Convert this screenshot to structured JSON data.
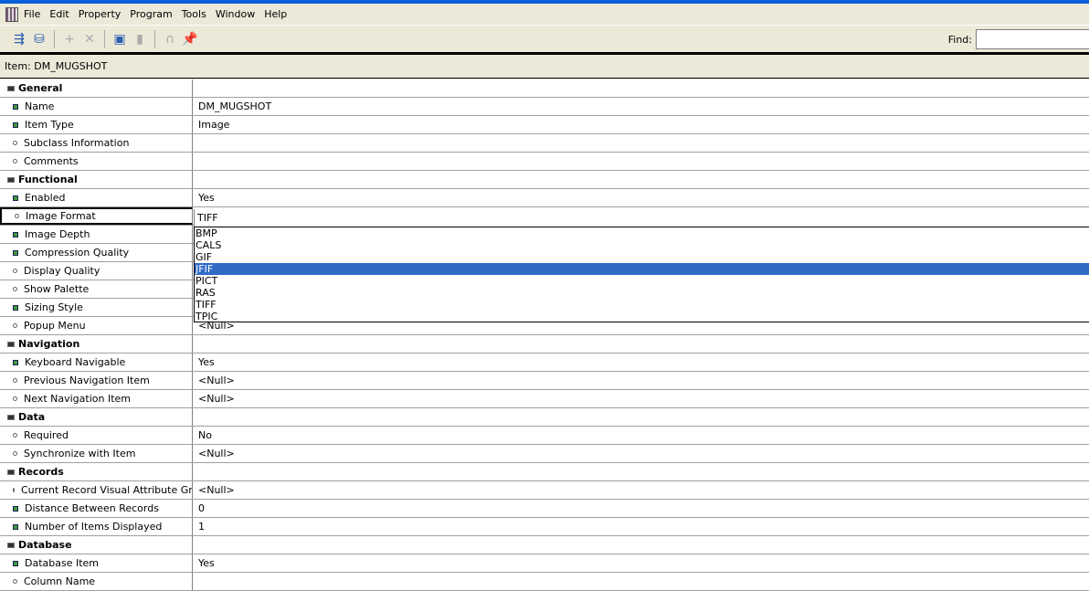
{
  "menu": [
    "File",
    "Edit",
    "Property",
    "Program",
    "Tools",
    "Window",
    "Help"
  ],
  "toolbar": {
    "icons": [
      "expand-tree-icon",
      "collapse-tree-icon",
      "add-property-icon",
      "delete-property-icon",
      "copy-properties-icon",
      "paste-properties-icon",
      "intersection-icon",
      "pin-icon"
    ],
    "find_label": "Find:",
    "find_value": ""
  },
  "item_label": "Item: DM_MUGSHOT",
  "rows": [
    {
      "type": "cat",
      "label": "General"
    },
    {
      "type": "sq",
      "label": "Name",
      "value": "DM_MUGSHOT"
    },
    {
      "type": "sq",
      "label": "Item Type",
      "value": "Image"
    },
    {
      "type": "dot",
      "label": "Subclass Information",
      "value": ""
    },
    {
      "type": "dot",
      "label": "Comments",
      "value": ""
    },
    {
      "type": "cat",
      "label": "Functional"
    },
    {
      "type": "sq",
      "label": "Enabled",
      "value": "Yes"
    },
    {
      "type": "dot",
      "label": "Image Format",
      "value": "TIFF",
      "selected": true
    },
    {
      "type": "sq",
      "label": "Image Depth",
      "value": ""
    },
    {
      "type": "sq",
      "label": "Compression Quality",
      "value": ""
    },
    {
      "type": "dot",
      "label": "Display Quality",
      "value": ""
    },
    {
      "type": "dot",
      "label": "Show Palette",
      "value": ""
    },
    {
      "type": "sq",
      "label": "Sizing Style",
      "value": ""
    },
    {
      "type": "dot",
      "label": "Popup Menu",
      "value": "<Null>"
    },
    {
      "type": "cat",
      "label": "Navigation"
    },
    {
      "type": "sq",
      "label": "Keyboard Navigable",
      "value": "Yes"
    },
    {
      "type": "dot",
      "label": "Previous Navigation Item",
      "value": "<Null>"
    },
    {
      "type": "dot",
      "label": "Next Navigation Item",
      "value": "<Null>"
    },
    {
      "type": "cat",
      "label": "Data"
    },
    {
      "type": "dot",
      "label": "Required",
      "value": "No"
    },
    {
      "type": "dot",
      "label": "Synchronize with Item",
      "value": "<Null>"
    },
    {
      "type": "cat",
      "label": "Records"
    },
    {
      "type": "dot",
      "label": "Current Record Visual Attribute Group",
      "value": "<Null>"
    },
    {
      "type": "sq",
      "label": "Distance Between Records",
      "value": "0"
    },
    {
      "type": "sq",
      "label": "Number of Items Displayed",
      "value": "1"
    },
    {
      "type": "cat",
      "label": "Database"
    },
    {
      "type": "sq",
      "label": "Database Item",
      "value": "Yes"
    },
    {
      "type": "dot",
      "label": "Column Name",
      "value": ""
    }
  ],
  "dropdown": {
    "options": [
      "BMP",
      "CALS",
      "GIF",
      "JFIF",
      "PICT",
      "RAS",
      "TIFF",
      "TPIC"
    ],
    "highlighted": "JFIF",
    "current": "TIFF"
  }
}
